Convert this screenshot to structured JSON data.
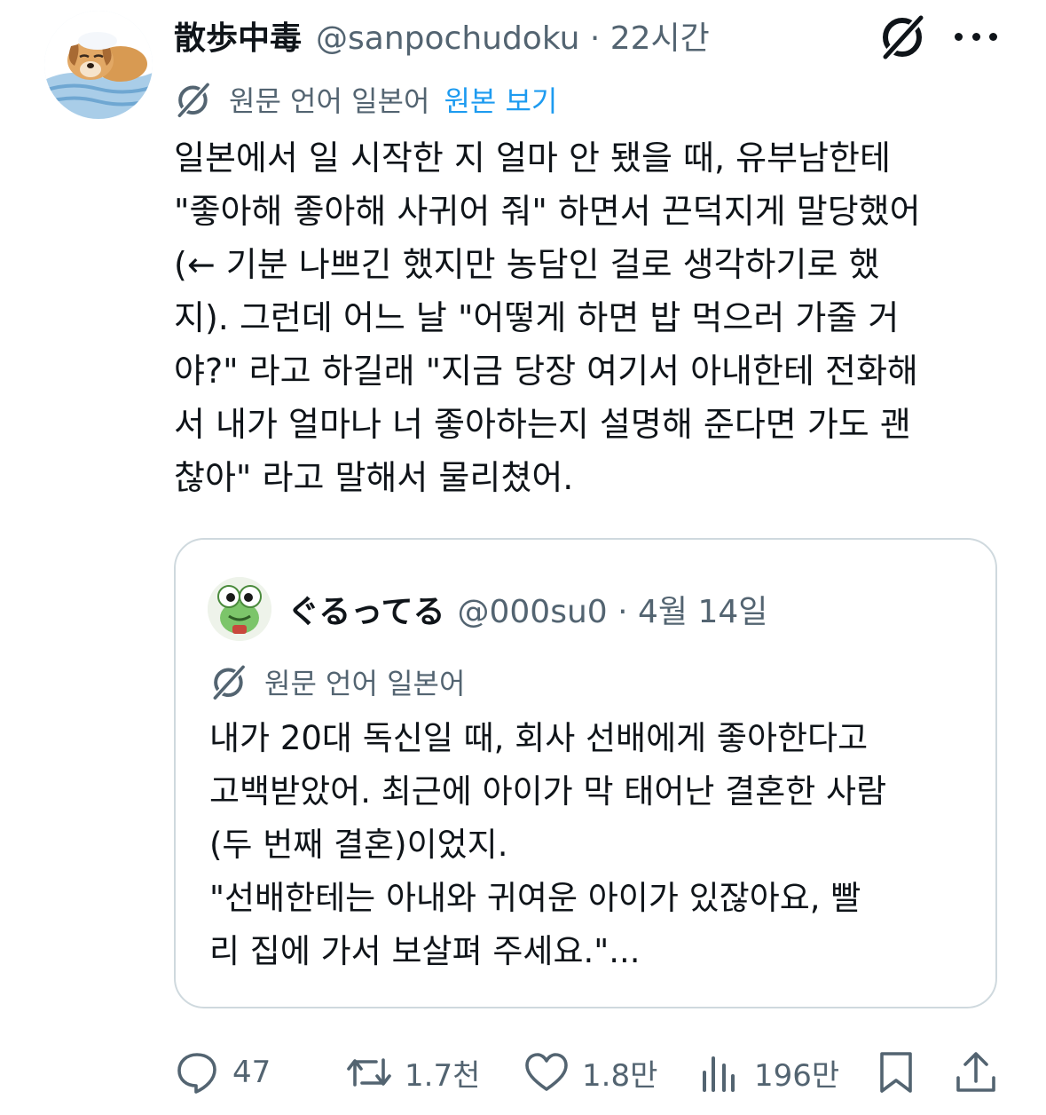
{
  "tweet": {
    "author_name": "散歩中毒",
    "handle_time": "@sanpochudoku · 22시간",
    "translation_label": "원문 언어 일본어",
    "view_original": "원본 보기",
    "body_lines": [
      "일본에서 일 시작한 지 얼마 안 됐을 때, 유부남한테",
      "\"좋아해 좋아해 사귀어 줘\" 하면서 끈덕지게 말당했어",
      "(← 기분 나쁘긴 했지만 농담인 걸로 생각하기로 했",
      "지). 그런데 어느 날 \"어떻게 하면 밥 먹으러 가줄 거",
      "야?\" 라고 하길래 \"지금 당장 여기서 아내한테 전화해",
      "서 내가 얼마나 너 좋아하는지 설명해 준다면 가도 괜",
      "찮아\" 라고 말해서 물리쳤어."
    ]
  },
  "quoted": {
    "author_name": "ぐるってる",
    "handle_time": "@000su0 · 4월 14일",
    "translation_label": "원문 언어 일본어",
    "body_lines": [
      "내가 20대 독신일 때, 회사 선배에게 좋아한다고",
      "고백받았어. 최근에 아이가 막 태어난 결혼한 사람",
      "(두 번째 결혼)이었지.",
      "\"선배한테는 아내와 귀여운 아이가 있잖아요, 빨",
      "리 집에 가서 보살펴 주세요.\"..."
    ]
  },
  "actions": {
    "replies": "47",
    "reposts": "1.7천",
    "likes": "1.8만",
    "views": "196만"
  },
  "icons": {
    "grok": "grok-icon",
    "more": "more-icon",
    "translate": "translate-icon",
    "reply": "reply-icon",
    "repost": "repost-icon",
    "like": "heart-icon",
    "views": "analytics-icon",
    "bookmark": "bookmark-icon",
    "share": "share-icon"
  },
  "colors": {
    "text": "#0f1419",
    "secondary": "#536471",
    "link": "#1d9bf0",
    "border": "#cfd9de"
  }
}
